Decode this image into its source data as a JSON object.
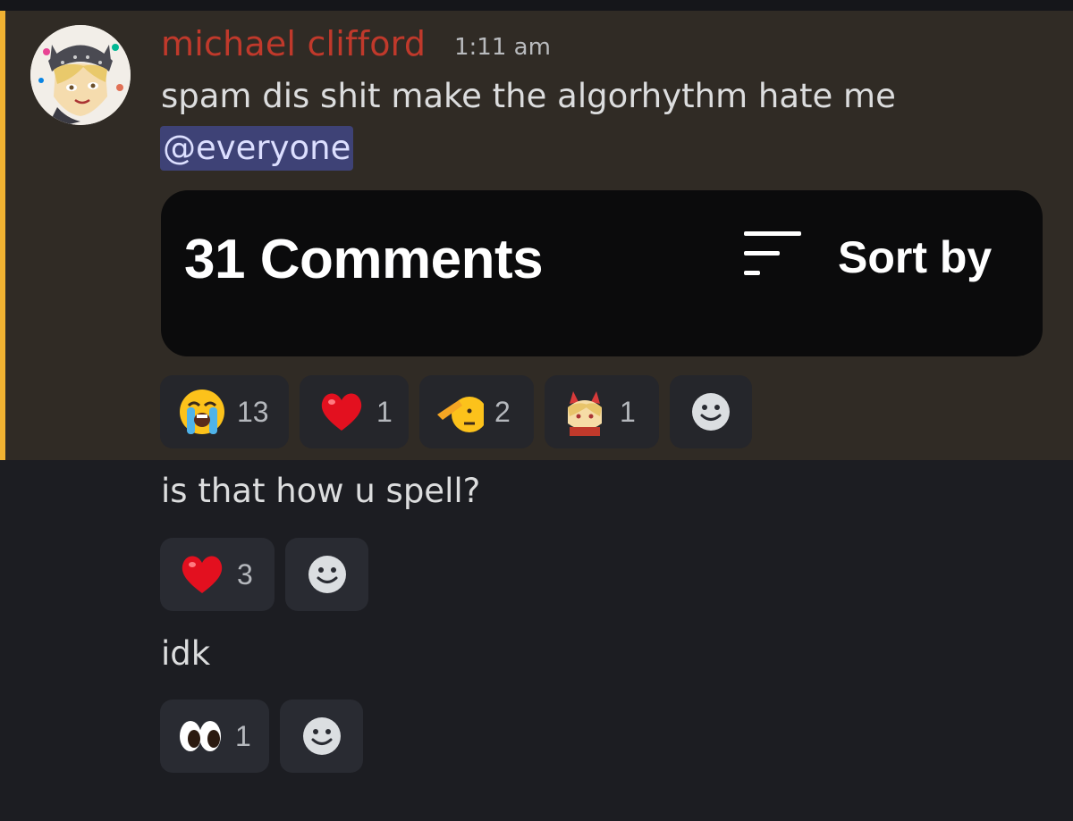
{
  "message": {
    "author": "michael clifford",
    "timestamp": "1:11 am",
    "text": "spam dis shit make the algorhythm hate me",
    "mention": "@everyone",
    "embed": {
      "comment_count_label": "31 Comments",
      "sort_label": "Sort by",
      "sort_icon": "sort-lines-icon"
    },
    "reactions": [
      {
        "emoji": "loudly-crying-face",
        "count": "13"
      },
      {
        "emoji": "red-heart",
        "count": "1"
      },
      {
        "emoji": "saluting-face",
        "count": "2"
      },
      {
        "emoji": "custom-anime-emoji",
        "count": "1"
      }
    ],
    "add_reaction_icon": "add-reaction-smiley-icon"
  },
  "followups": [
    {
      "text": "is that how u spell?",
      "reactions": [
        {
          "emoji": "red-heart",
          "count": "3"
        }
      ]
    },
    {
      "text": "idk",
      "reactions": [
        {
          "emoji": "eyes",
          "count": "1"
        }
      ]
    }
  ],
  "colors": {
    "background": "#1c1d22",
    "highlight_background": "#302b25",
    "highlight_accent": "#f0b232",
    "author": "#c0392b",
    "mention_background": "#3e4276",
    "reaction_background": "#292b32"
  }
}
